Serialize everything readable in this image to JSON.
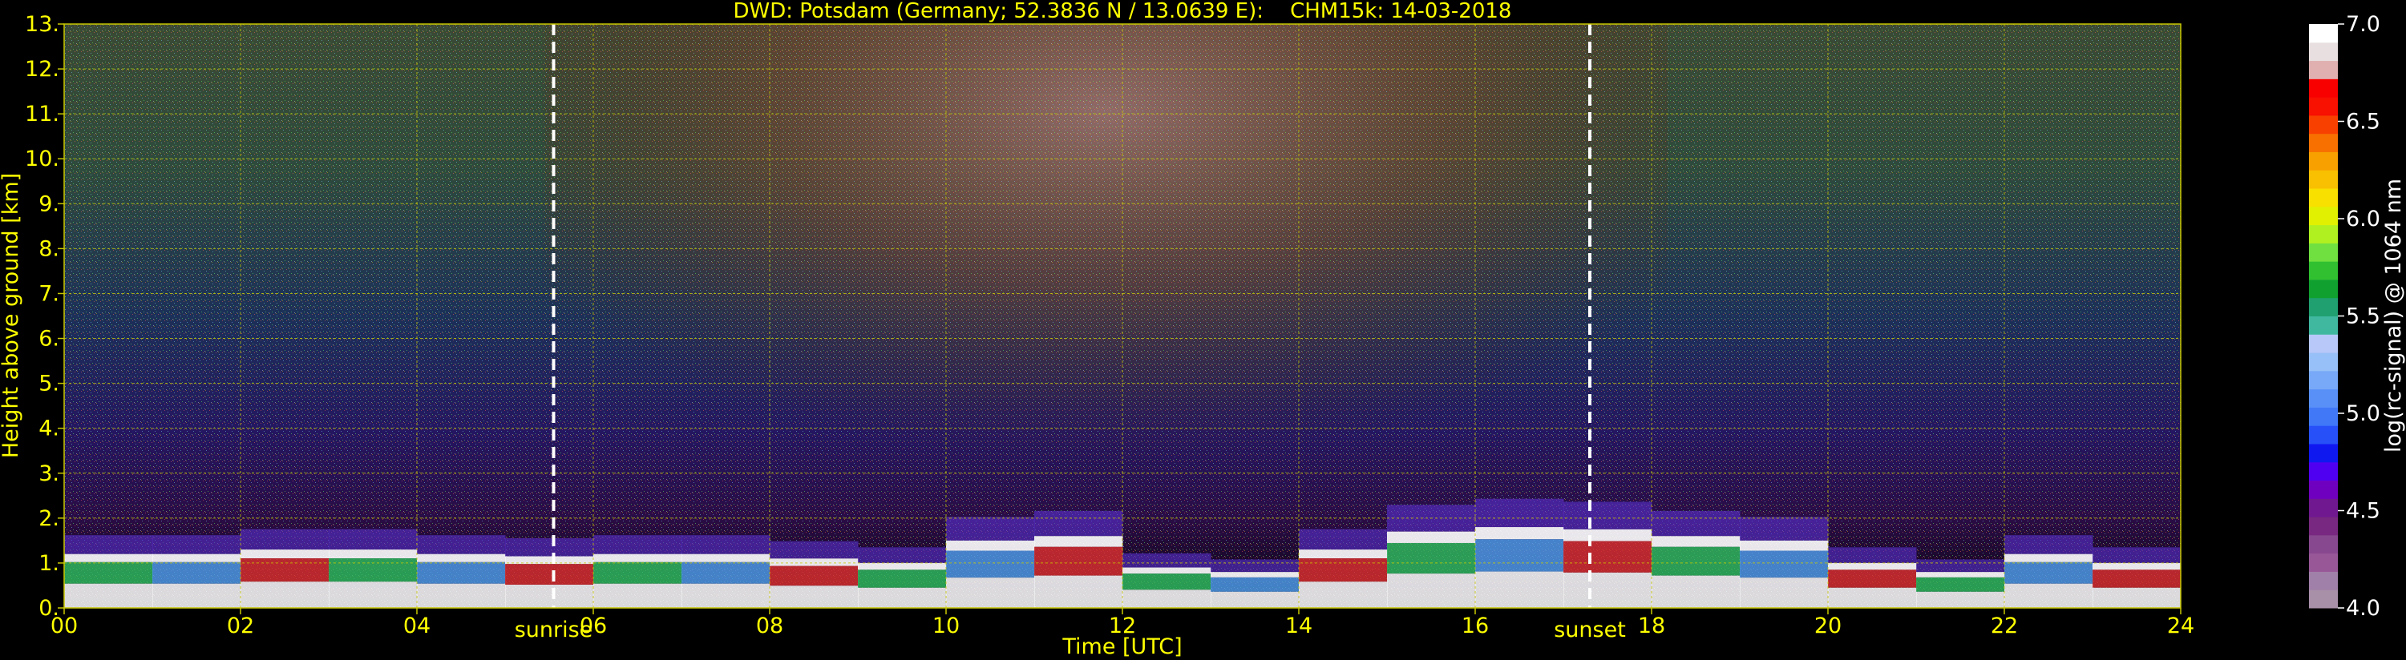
{
  "chart_data": {
    "type": "heatmap",
    "title": "DWD: Potsdam (Germany; 52.3836 N / 13.0639 E):    CHM15k: 14-03-2018",
    "xlabel": "Time [UTC]",
    "ylabel": "Height above ground [km]",
    "xlim": [
      0,
      24
    ],
    "ylim": [
      0,
      13
    ],
    "x_ticks": [
      0,
      2,
      4,
      6,
      8,
      10,
      12,
      14,
      16,
      18,
      20,
      22,
      24
    ],
    "x_tick_labels": [
      "00",
      "02",
      "04",
      "06",
      "08",
      "10",
      "12",
      "14",
      "16",
      "18",
      "20",
      "22",
      "24"
    ],
    "y_ticks": [
      0,
      1,
      2,
      3,
      4,
      5,
      6,
      7,
      8,
      9,
      10,
      11,
      12,
      13
    ],
    "y_tick_labels": [
      "0.",
      "1.",
      "2.",
      "3.",
      "4.",
      "5.",
      "6.",
      "7.",
      "8.",
      "9.",
      "10.",
      "11.",
      "12.",
      "13."
    ],
    "grid": true,
    "markers": [
      {
        "label": "sunrise",
        "x": 5.55
      },
      {
        "label": "sunset",
        "x": 17.3
      }
    ],
    "colorbar": {
      "label": "log(rc-signal) @ 1064 nm",
      "range": [
        4.0,
        7.0
      ],
      "ticks": [
        4.0,
        4.5,
        5.0,
        5.5,
        6.0,
        6.5,
        7.0
      ],
      "tick_labels": [
        "4.0",
        "4.5",
        "5.0",
        "5.5",
        "6.0",
        "6.5",
        "7.0"
      ],
      "colors": [
        "#a890a8",
        "#a080a8",
        "#985898",
        "#884890",
        "#782880",
        "#701890",
        "#7000c0",
        "#5000f0",
        "#1018f0",
        "#2850f8",
        "#4078f8",
        "#5890f8",
        "#78a8f8",
        "#98c0f8",
        "#b8c8f8",
        "#40b8a0",
        "#20a070",
        "#10a030",
        "#30c030",
        "#70e040",
        "#b0f020",
        "#e0f000",
        "#f8e000",
        "#f8c000",
        "#f8a000",
        "#f87000",
        "#f84000",
        "#f81000",
        "#f80000",
        "#e0b0b0",
        "#e8e0e0",
        "#ffffff"
      ]
    },
    "color_scale": {
      "background_low": "#000000",
      "grid_color": "#c8c800",
      "text_color": "#ffff00"
    }
  }
}
